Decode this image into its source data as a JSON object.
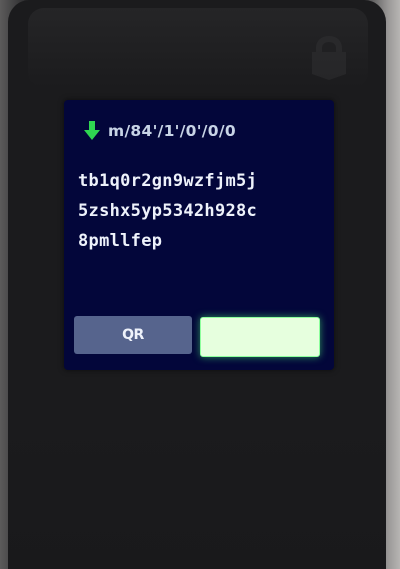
{
  "screen": {
    "derivation_path": "m/84'/1'/0'/0/0",
    "address_lines": [
      "tb1q0r2gn9wzfjm5j",
      "5zshx5yp5342h928c",
      "8pmllfep"
    ],
    "qr_button_label": "QR",
    "confirm_button_label": ""
  },
  "icons": {
    "header": "down-arrow-icon",
    "device_logo": "shield-logo-icon"
  },
  "colors": {
    "screen_background": "#03063a",
    "accent_green": "#2fd651",
    "qr_button": "#56648d",
    "confirm_button": "#e6ffde",
    "text": "#eef2fb"
  }
}
